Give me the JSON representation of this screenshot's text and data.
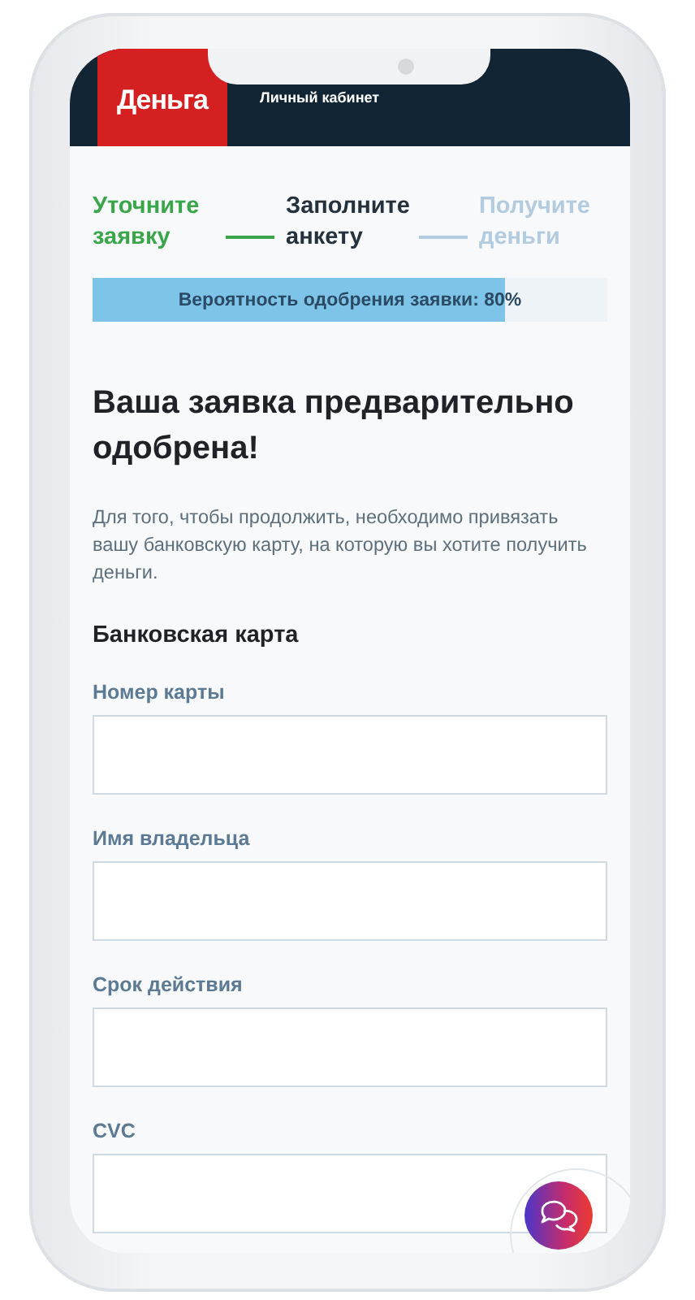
{
  "header": {
    "logo": "Деньга",
    "title": "Личный кабинет"
  },
  "steps": [
    {
      "label": "Уточните заявку",
      "completed": true,
      "selected": false
    },
    {
      "label": "Заполните анкету",
      "completed": false,
      "selected": true
    },
    {
      "label": "Получите деньги",
      "completed": false,
      "selected": false
    }
  ],
  "approval": {
    "text": "Вероятность одобрения заявки: 80%",
    "level": 0.8
  },
  "heading": "Ваша заявка предварительно одобрена!",
  "description": "Для того, чтобы продолжить, необходимо привязать вашу банковскую карту, на которую вы хотите получить деньги.",
  "section_title": "Банковская карта",
  "fields": [
    {
      "label": "Номер карты"
    },
    {
      "label": "Имя владельца"
    },
    {
      "label": "Срок действия"
    },
    {
      "label": "CVC"
    }
  ]
}
